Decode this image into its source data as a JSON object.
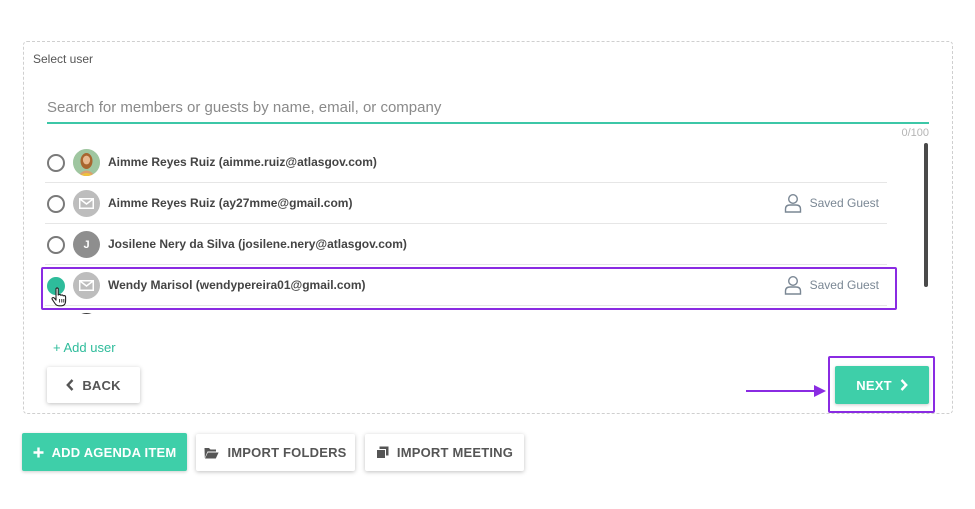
{
  "panel": {
    "label": "Select user",
    "search": {
      "placeholder": "Search for members or guests by name, email, or company",
      "value": ""
    },
    "counter": "0/100",
    "users": [
      {
        "name": "Aimme Reyes Ruiz (aimme.ruiz@atlasgov.com)",
        "avatar": "photo",
        "avatar_text": "",
        "selected": false,
        "tag": ""
      },
      {
        "name": "Aimme Reyes Ruiz (ay27mme@gmail.com)",
        "avatar": "envelope-icon",
        "avatar_text": "",
        "selected": false,
        "tag": "Saved Guest"
      },
      {
        "name": "Josilene Nery da Silva (josilene.nery@atlasgov.com)",
        "avatar": "letter",
        "avatar_text": "J",
        "selected": false,
        "tag": ""
      },
      {
        "name": "Wendy Marisol (wendypereira01@gmail.com)",
        "avatar": "envelope-icon",
        "avatar_text": "",
        "selected": true,
        "tag": "Saved Guest"
      }
    ],
    "add_user_label": "+ Add user",
    "back_label": "BACK",
    "next_label": "NEXT"
  },
  "toolbar": {
    "add_agenda_label": "ADD AGENDA ITEM",
    "import_folders_label": "IMPORT FOLDERS",
    "import_meeting_label": "IMPORT MEETING"
  },
  "colors": {
    "accent": "#3ecfa9",
    "annotation": "#8a2be2"
  }
}
